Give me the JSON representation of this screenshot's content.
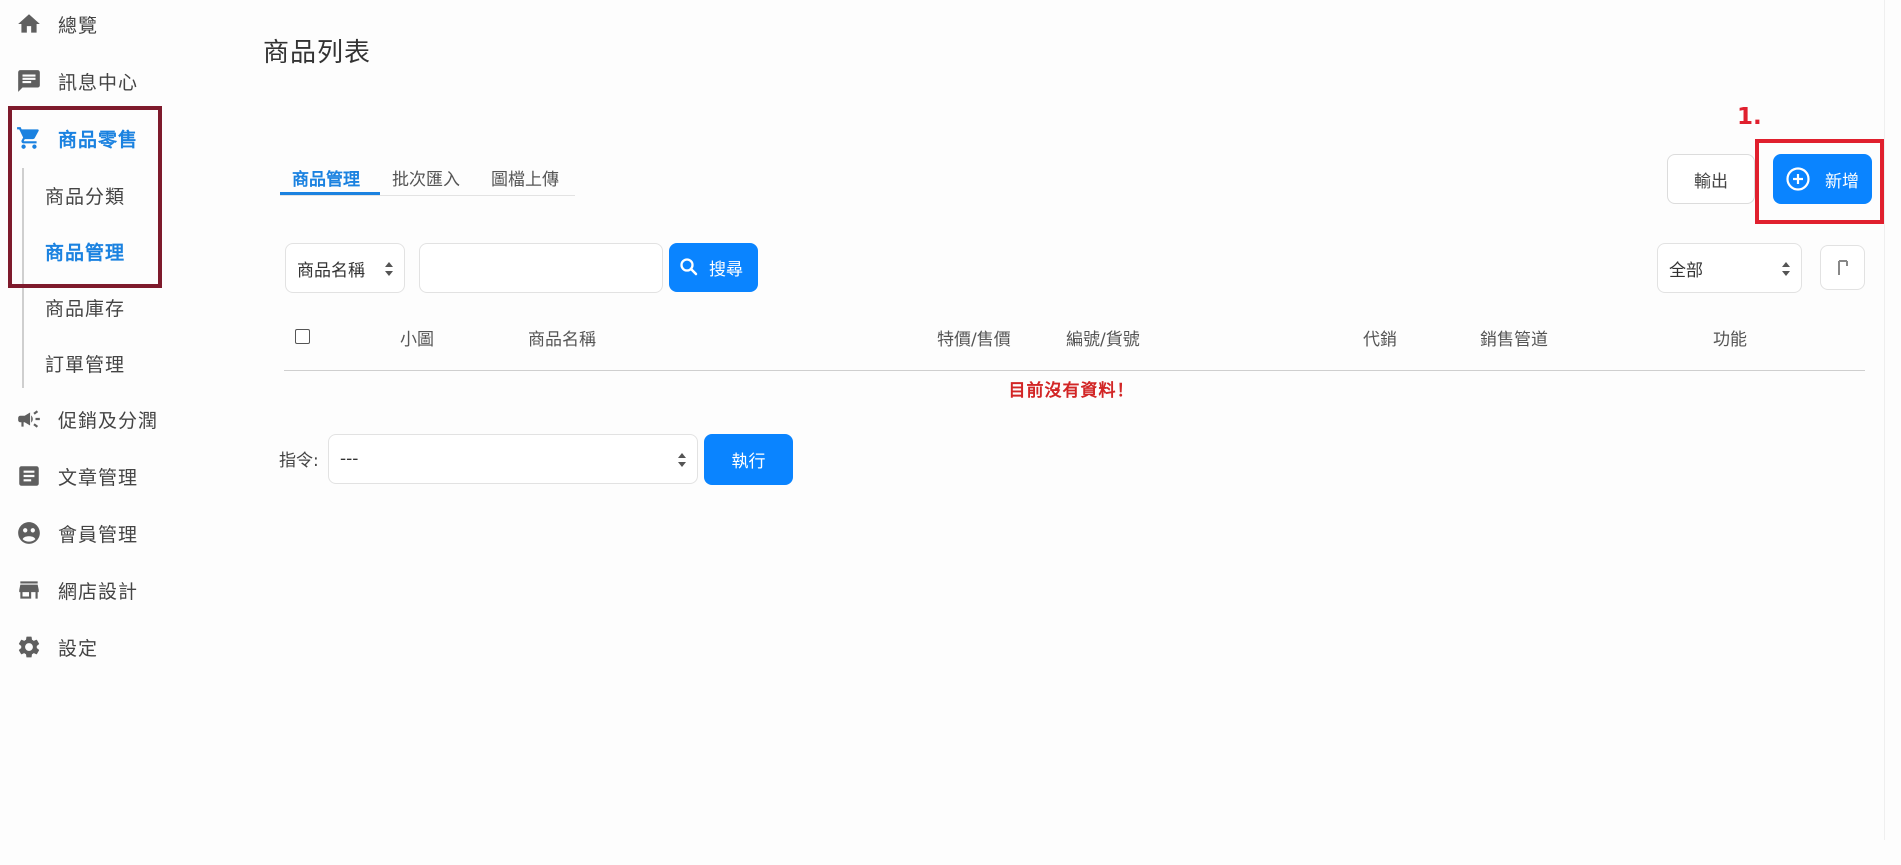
{
  "page_title": "商品列表",
  "annotation": {
    "step": "1."
  },
  "sidebar": {
    "items": [
      {
        "label": "總覽",
        "icon": "home-icon"
      },
      {
        "label": "訊息中心",
        "icon": "message-icon"
      },
      {
        "label": "商品零售",
        "icon": "cart-icon",
        "active": true
      },
      {
        "label": "促銷及分潤",
        "icon": "megaphone-icon"
      },
      {
        "label": "文章管理",
        "icon": "article-icon"
      },
      {
        "label": "會員管理",
        "icon": "members-icon"
      },
      {
        "label": "網店設計",
        "icon": "store-icon"
      },
      {
        "label": "設定",
        "icon": "gear-icon"
      }
    ],
    "subitems": [
      {
        "label": "商品分類"
      },
      {
        "label": "商品管理",
        "active": true
      },
      {
        "label": "商品庫存"
      },
      {
        "label": "訂單管理"
      }
    ]
  },
  "tabs": [
    {
      "label": "商品管理",
      "active": true
    },
    {
      "label": "批次匯入"
    },
    {
      "label": "圖檔上傳"
    }
  ],
  "toolbar": {
    "export_label": "輸出",
    "add_label": "新增"
  },
  "search": {
    "field_select": "商品名稱",
    "input_value": "",
    "button_label": "搜尋",
    "filter_select": "全部"
  },
  "table": {
    "columns": [
      "小圖",
      "商品名稱",
      "特價/售價",
      "編號/貨號",
      "代銷",
      "銷售管道",
      "功能"
    ],
    "empty_message": "目前沒有資料！"
  },
  "command": {
    "label": "指令:",
    "select_value": "---",
    "execute_label": "執行"
  },
  "colors": {
    "primary": "#0a84ff",
    "active_text": "#1b82e0",
    "highlight_red": "#e0202e",
    "highlight_maroon": "#7e1a2c",
    "empty_text": "#d22626"
  }
}
